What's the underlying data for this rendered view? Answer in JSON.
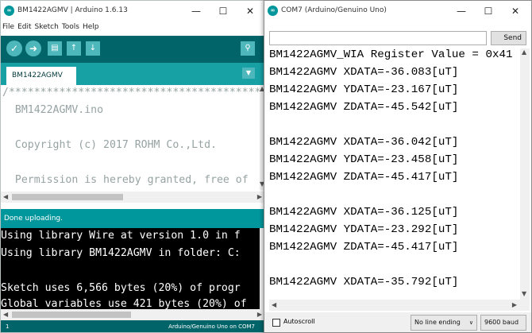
{
  "ide": {
    "title": "BM1422AGMV | Arduino 1.6.13",
    "app_icon": "arduino-logo-icon",
    "menu": [
      "File",
      "Edit",
      "Sketch",
      "Tools",
      "Help"
    ],
    "toolbar_icons": [
      "verify-icon",
      "upload-icon",
      "new-icon",
      "open-icon",
      "save-icon",
      "serial-monitor-icon"
    ],
    "tab_label": "BM1422AGMV",
    "code_lines": [
      "/*****************************************",
      "  BM1422AGMV.ino",
      "",
      "  Copyright (c) 2017 ROHM Co.,Ltd.",
      "",
      "  Permission is hereby granted, free of"
    ],
    "status_text": "Done uploading.",
    "console_lines": [
      "Using library Wire at version 1.0 in f",
      "Using library BM1422AGMV in folder: C:",
      "",
      "Sketch uses 6,566 bytes (20%) of progr",
      "Global variables use 421 bytes (20%) of"
    ],
    "footer_line": "1",
    "footer_board": "Arduino/Genuino Uno on COM7",
    "colors": {
      "toolbar": "#006468",
      "tabbar": "#17a1a5",
      "status": "#00979c",
      "console": "#000000"
    }
  },
  "serial": {
    "title": "COM7 (Arduino/Genuino Uno)",
    "app_icon": "arduino-logo-icon",
    "input_value": "",
    "send_label": "Send",
    "output_lines": [
      "BM1422AGMV_WIA Register Value = 0x41",
      "BM1422AGMV XDATA=-36.083[uT]",
      "BM1422AGMV YDATA=-23.167[uT]",
      "BM1422AGMV ZDATA=-45.542[uT]",
      "",
      "BM1422AGMV XDATA=-36.042[uT]",
      "BM1422AGMV YDATA=-23.458[uT]",
      "BM1422AGMV ZDATA=-45.417[uT]",
      "",
      "BM1422AGMV XDATA=-36.125[uT]",
      "BM1422AGMV YDATA=-23.292[uT]",
      "BM1422AGMV ZDATA=-45.417[uT]",
      "",
      "BM1422AGMV XDATA=-35.792[uT]"
    ],
    "autoscroll_label": "Autoscroll",
    "autoscroll_checked": false,
    "line_ending": "No line ending",
    "baud": "9600 baud"
  },
  "window_controls": {
    "minimize": "—",
    "maximize": "☐",
    "close": "✕"
  }
}
